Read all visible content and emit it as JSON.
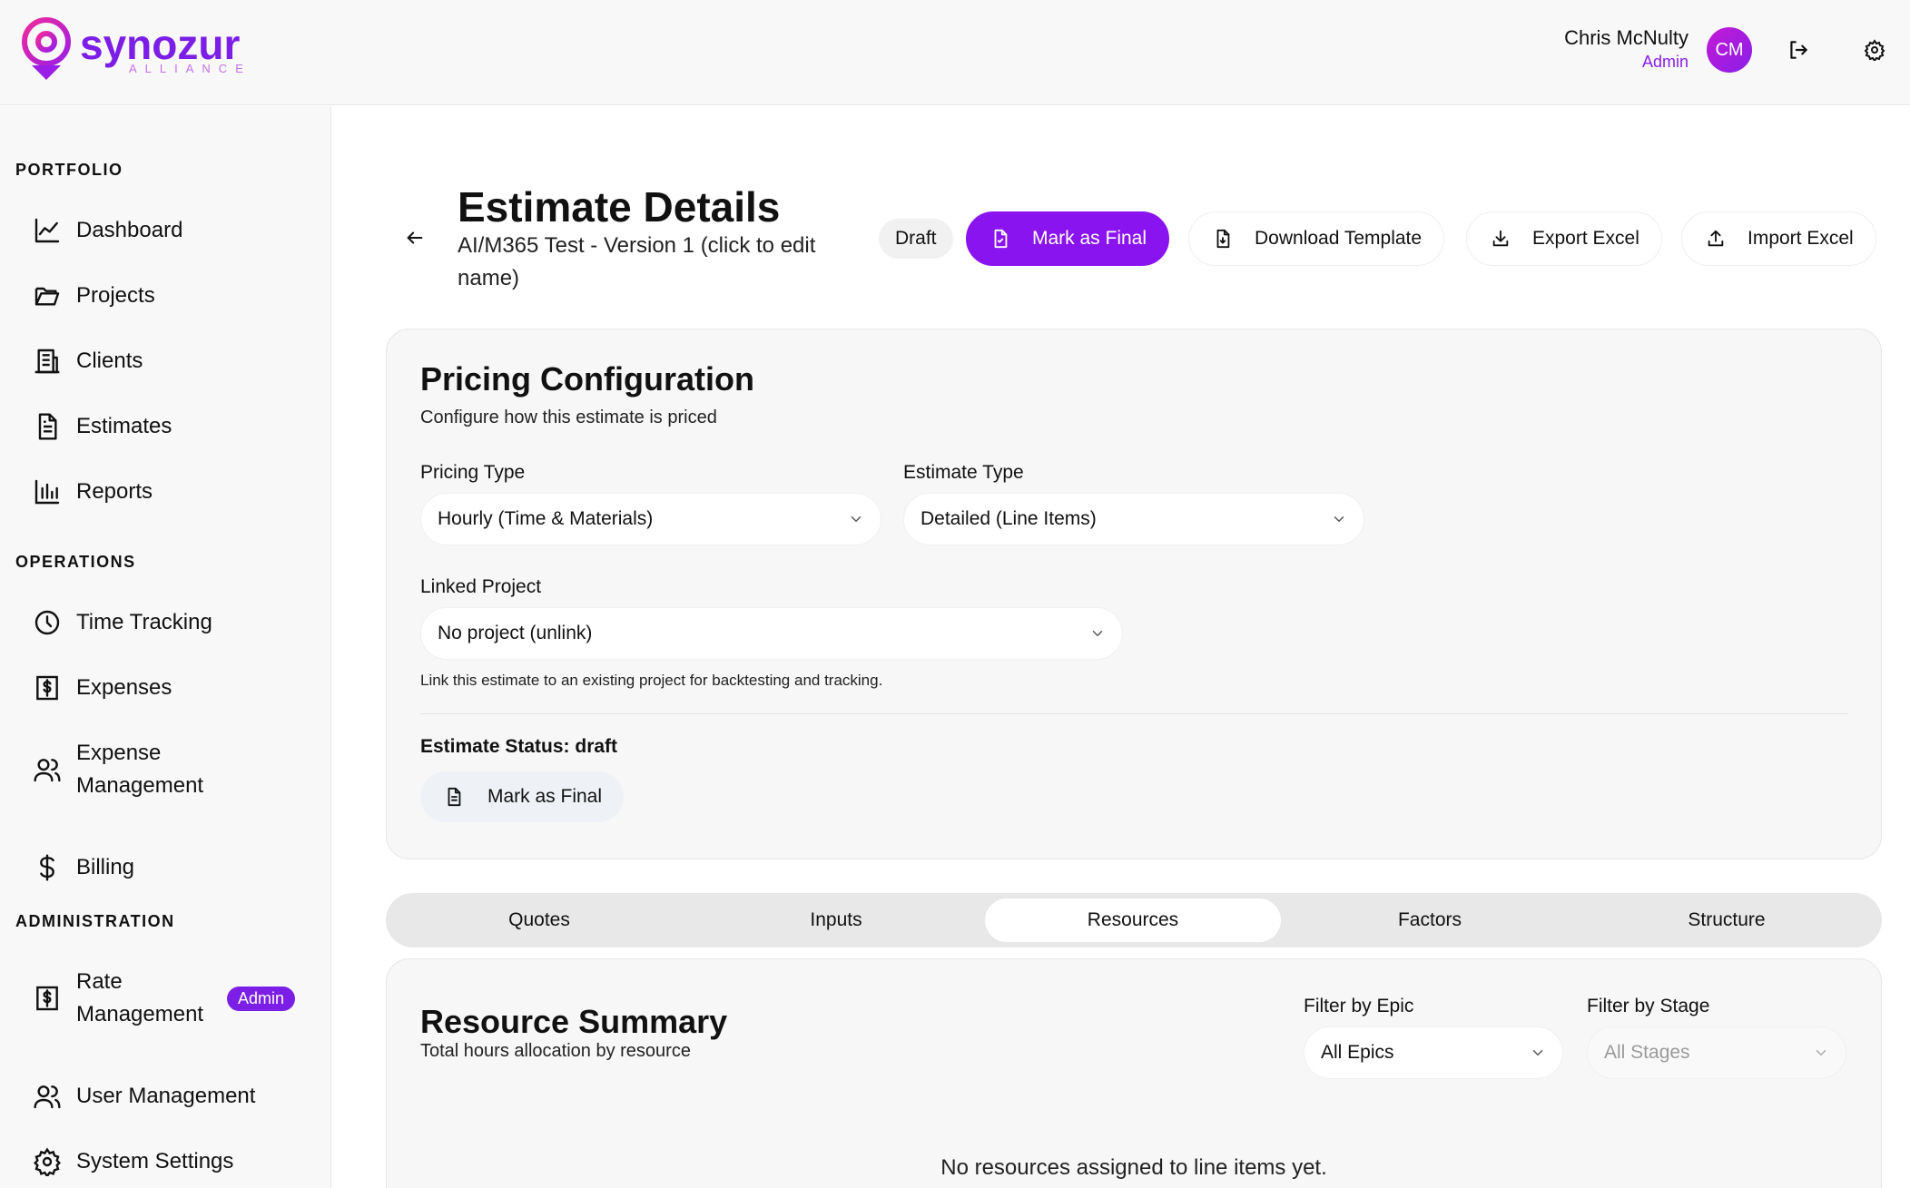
{
  "header": {
    "logo_name": "synozur",
    "logo_sub": "ALLIANCE",
    "user_name": "Chris McNulty",
    "user_role": "Admin",
    "avatar_initials": "CM"
  },
  "sidebar": {
    "sections": [
      {
        "title": "PORTFOLIO"
      },
      {
        "title": "OPERATIONS"
      },
      {
        "title": "ADMINISTRATION"
      }
    ],
    "items": [
      {
        "label": "Dashboard"
      },
      {
        "label": "Projects"
      },
      {
        "label": "Clients"
      },
      {
        "label": "Estimates"
      },
      {
        "label": "Reports"
      },
      {
        "label": "Time Tracking"
      },
      {
        "label": "Expenses"
      },
      {
        "label_line1": "Expense",
        "label_line2": "Management"
      },
      {
        "label": "Billing"
      },
      {
        "label_line1": "Rate",
        "label_line2": "Management",
        "badge": "Admin"
      },
      {
        "label": "User Management"
      },
      {
        "label": "System Settings"
      }
    ]
  },
  "page": {
    "title": "Estimate Details",
    "subtitle": "AI/M365 Test - Version 1 (click to edit name)",
    "status_badge": "Draft",
    "actions": {
      "mark_final": "Mark as Final",
      "download_template": "Download Template",
      "export_excel": "Export Excel",
      "import_excel": "Import Excel"
    }
  },
  "pricing": {
    "title": "Pricing Configuration",
    "description": "Configure how this estimate is priced",
    "pricing_type_label": "Pricing Type",
    "pricing_type_value": "Hourly (Time & Materials)",
    "estimate_type_label": "Estimate Type",
    "estimate_type_value": "Detailed (Line Items)",
    "linked_project_label": "Linked Project",
    "linked_project_value": "No project (unlink)",
    "linked_project_hint": "Link this estimate to an existing project for backtesting and tracking.",
    "status_label": "Estimate Status: draft",
    "mark_final": "Mark as Final"
  },
  "tabs": [
    {
      "label": "Quotes"
    },
    {
      "label": "Inputs"
    },
    {
      "label": "Resources",
      "active": true
    },
    {
      "label": "Factors"
    },
    {
      "label": "Structure"
    }
  ],
  "resource_summary": {
    "title": "Resource Summary",
    "description": "Total hours allocation by resource",
    "filter_epic_label": "Filter by Epic",
    "filter_epic_value": "All Epics",
    "filter_stage_label": "Filter by Stage",
    "filter_stage_value": "All Stages",
    "empty_message": "No resources assigned to line items yet."
  },
  "colors": {
    "brand_purple": "#8a14f0",
    "brand_magenta": "#e01fa8"
  }
}
